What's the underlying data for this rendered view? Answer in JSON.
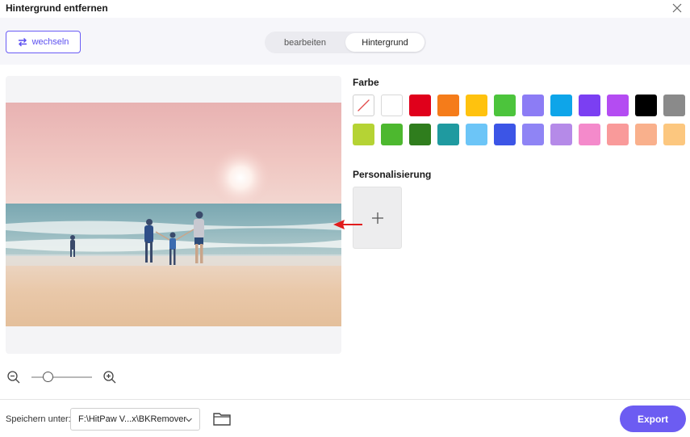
{
  "window": {
    "title": "Hintergrund entfernen"
  },
  "toolbar": {
    "switch_label": "wechseln"
  },
  "tabs": [
    {
      "label": "bearbeiten",
      "active": false
    },
    {
      "label": "Hintergrund",
      "active": true
    }
  ],
  "panel": {
    "color_title": "Farbe",
    "custom_title": "Personalisierung",
    "colors_row1": [
      "none",
      "#ffffff",
      "#e0001b",
      "#f57c1a",
      "#ffc20e",
      "#4cc43c",
      "#8c7cf5",
      "#0ea5e9",
      "#7b3ff2",
      "#b44cf2",
      "#000000",
      "#8a8a8a"
    ],
    "colors_row2": [
      "#b5d334",
      "#4db82f",
      "#2f7d1d",
      "#1f9aa0",
      "#6cc5f7",
      "#3c55e6",
      "#8f84f5",
      "#b58ae8",
      "#f48acb",
      "#f99a9a",
      "#f9b08c",
      "#fcc77f"
    ]
  },
  "zoom": {
    "level": 0.18
  },
  "footer": {
    "save_label": "Speichern unter:",
    "path": "F:\\HitPaw V...x\\BKRemover",
    "export_label": "Export"
  },
  "accent": "#6c5cf2"
}
